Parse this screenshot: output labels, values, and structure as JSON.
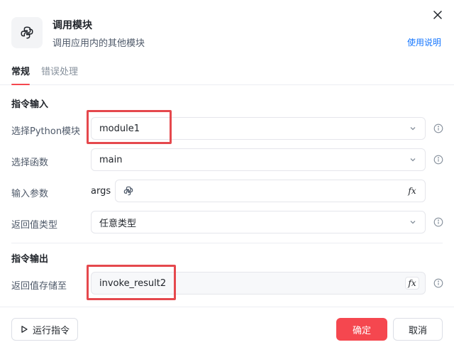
{
  "header": {
    "title": "调用模块",
    "subtitle": "调用应用内的其他模块",
    "help_link": "使用说明",
    "icon": "python-icon",
    "close_icon": "close-icon"
  },
  "tabs": [
    {
      "label": "常规",
      "active": true
    },
    {
      "label": "错误处理",
      "active": false
    }
  ],
  "input_section": {
    "title": "指令输入",
    "rows": [
      {
        "label": "选择Python模块",
        "value": "module1",
        "control": "select"
      },
      {
        "label": "选择函数",
        "value": "main",
        "control": "select"
      },
      {
        "label": "输入参数",
        "prefix": "args",
        "value": "",
        "control": "expression"
      },
      {
        "label": "返回值类型",
        "value": "任意类型",
        "control": "select"
      }
    ]
  },
  "output_section": {
    "title": "指令输出",
    "rows": [
      {
        "label": "返回值存储至",
        "value": "invoke_result2",
        "control": "expression"
      }
    ]
  },
  "fx_label": "fx",
  "footer": {
    "run_label": "运行指令",
    "ok_label": "确定",
    "cancel_label": "取消"
  },
  "colors": {
    "accent": "#f5474f",
    "link": "#1677ff",
    "highlight": "#e5484d"
  }
}
